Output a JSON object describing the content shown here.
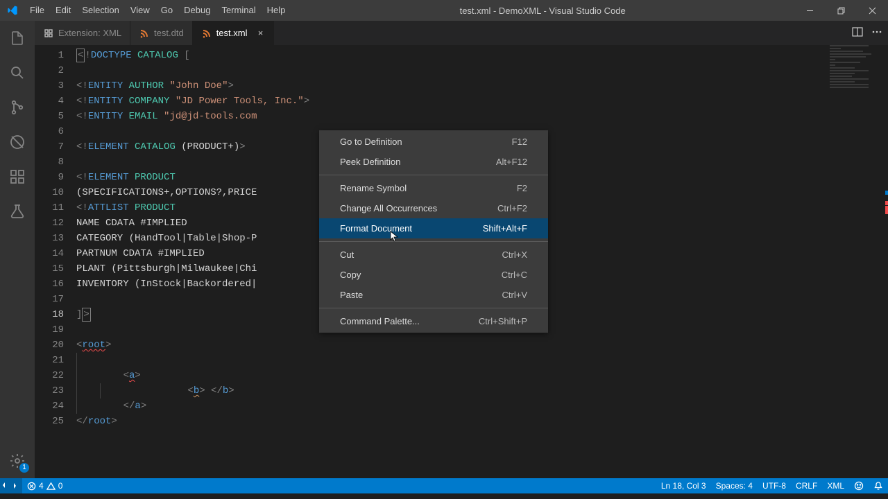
{
  "title": "test.xml - DemoXML - Visual Studio Code",
  "menus": [
    "File",
    "Edit",
    "Selection",
    "View",
    "Go",
    "Debug",
    "Terminal",
    "Help"
  ],
  "activity_badge": "1",
  "tabs": [
    {
      "label": "Extension: XML",
      "icon": "puzzle",
      "active": false,
      "show_close": false
    },
    {
      "label": "test.dtd",
      "icon": "xml",
      "active": false,
      "show_close": false
    },
    {
      "label": "test.xml",
      "icon": "xml",
      "active": true,
      "show_close": true
    }
  ],
  "current_line": 18,
  "code_lines": [
    {
      "n": 1,
      "segs": [
        {
          "t": "span",
          "cls": "box k-gray",
          "v": "<"
        },
        {
          "t": "span",
          "cls": "k-gray",
          "v": "!"
        },
        {
          "t": "span",
          "cls": "k-blue",
          "v": "DOCTYPE "
        },
        {
          "t": "span",
          "cls": "k-teal",
          "v": "CATALOG"
        },
        {
          "t": "span",
          "cls": "",
          "v": " "
        },
        {
          "t": "span",
          "cls": "k-gray",
          "v": "["
        }
      ]
    },
    {
      "n": 2,
      "segs": []
    },
    {
      "n": 3,
      "segs": [
        {
          "t": "span",
          "cls": "k-gray",
          "v": "<!"
        },
        {
          "t": "span",
          "cls": "k-blue",
          "v": "ENTITY "
        },
        {
          "t": "span",
          "cls": "k-teal",
          "v": "AUTHOR"
        },
        {
          "t": "span",
          "cls": "",
          "v": " "
        },
        {
          "t": "span",
          "cls": "k-str",
          "v": "\"John Doe\""
        },
        {
          "t": "span",
          "cls": "k-gray",
          "v": ">"
        }
      ]
    },
    {
      "n": 4,
      "segs": [
        {
          "t": "span",
          "cls": "k-gray",
          "v": "<!"
        },
        {
          "t": "span",
          "cls": "k-blue",
          "v": "ENTITY "
        },
        {
          "t": "span",
          "cls": "k-teal",
          "v": "COMPANY"
        },
        {
          "t": "span",
          "cls": "",
          "v": " "
        },
        {
          "t": "span",
          "cls": "k-str",
          "v": "\"JD Power Tools, Inc.\""
        },
        {
          "t": "span",
          "cls": "k-gray",
          "v": ">"
        }
      ]
    },
    {
      "n": 5,
      "segs": [
        {
          "t": "span",
          "cls": "k-gray",
          "v": "<!"
        },
        {
          "t": "span",
          "cls": "k-blue",
          "v": "ENTITY "
        },
        {
          "t": "span",
          "cls": "k-teal",
          "v": "EMAIL"
        },
        {
          "t": "span",
          "cls": "",
          "v": " "
        },
        {
          "t": "span",
          "cls": "k-str",
          "v": "\"jd@jd-tools.com"
        }
      ]
    },
    {
      "n": 6,
      "segs": []
    },
    {
      "n": 7,
      "segs": [
        {
          "t": "span",
          "cls": "k-gray",
          "v": "<!"
        },
        {
          "t": "span",
          "cls": "k-blue",
          "v": "ELEMENT "
        },
        {
          "t": "span",
          "cls": "k-teal",
          "v": "CATALOG"
        },
        {
          "t": "span",
          "cls": "",
          "v": " (PRODUCT+)"
        },
        {
          "t": "span",
          "cls": "k-gray",
          "v": ">"
        }
      ]
    },
    {
      "n": 8,
      "segs": []
    },
    {
      "n": 9,
      "segs": [
        {
          "t": "span",
          "cls": "k-gray",
          "v": "<!"
        },
        {
          "t": "span",
          "cls": "k-blue",
          "v": "ELEMENT "
        },
        {
          "t": "span",
          "cls": "k-teal",
          "v": "PRODUCT"
        }
      ]
    },
    {
      "n": 10,
      "segs": [
        {
          "t": "span",
          "cls": "",
          "v": "(SPECIFICATIONS+,OPTIONS?,PRICE"
        }
      ]
    },
    {
      "n": 11,
      "segs": [
        {
          "t": "span",
          "cls": "k-gray",
          "v": "<!"
        },
        {
          "t": "span",
          "cls": "k-blue",
          "v": "ATTLIST "
        },
        {
          "t": "span",
          "cls": "k-teal",
          "v": "PRODUCT"
        }
      ]
    },
    {
      "n": 12,
      "segs": [
        {
          "t": "span",
          "cls": "",
          "v": "NAME CDATA #IMPLIED"
        }
      ]
    },
    {
      "n": 13,
      "segs": [
        {
          "t": "span",
          "cls": "",
          "v": "CATEGORY (HandTool|Table|Shop-P"
        }
      ]
    },
    {
      "n": 14,
      "segs": [
        {
          "t": "span",
          "cls": "",
          "v": "PARTNUM CDATA #IMPLIED"
        }
      ]
    },
    {
      "n": 15,
      "segs": [
        {
          "t": "span",
          "cls": "",
          "v": "PLANT (Pittsburgh|Milwaukee|Chi"
        }
      ]
    },
    {
      "n": 16,
      "segs": [
        {
          "t": "span",
          "cls": "",
          "v": "INVENTORY (InStock|Backordered|"
        }
      ]
    },
    {
      "n": 17,
      "segs": []
    },
    {
      "n": 18,
      "segs": [
        {
          "t": "span",
          "cls": "k-gray",
          "v": "]"
        },
        {
          "t": "span",
          "cls": "box k-gray",
          "v": ">"
        }
      ]
    },
    {
      "n": 19,
      "segs": []
    },
    {
      "n": 20,
      "segs": [
        {
          "t": "span",
          "cls": "k-gray",
          "v": "<"
        },
        {
          "t": "span",
          "cls": "k-blue squiggle-red",
          "v": "root"
        },
        {
          "t": "span",
          "cls": "k-gray",
          "v": ">"
        }
      ]
    },
    {
      "n": 21,
      "indent": 1,
      "segs": []
    },
    {
      "n": 22,
      "indent": 1,
      "segs": [
        {
          "t": "raw",
          "v": "    "
        },
        {
          "t": "span",
          "cls": "k-gray",
          "v": "<"
        },
        {
          "t": "span",
          "cls": "k-blue squiggle-red",
          "v": "a"
        },
        {
          "t": "span",
          "cls": "k-gray",
          "v": ">"
        }
      ]
    },
    {
      "n": 23,
      "indent": 2,
      "segs": [
        {
          "t": "raw",
          "v": "           "
        },
        {
          "t": "span",
          "cls": "k-gray",
          "v": "<"
        },
        {
          "t": "span",
          "cls": "k-blue squiggle-orange",
          "v": "b"
        },
        {
          "t": "span",
          "cls": "k-gray",
          "v": ">"
        },
        {
          "t": "raw",
          "v": " "
        },
        {
          "t": "span",
          "cls": "k-gray",
          "v": "</"
        },
        {
          "t": "span",
          "cls": "k-blue",
          "v": "b"
        },
        {
          "t": "span",
          "cls": "k-gray",
          "v": ">"
        }
      ]
    },
    {
      "n": 24,
      "indent": 1,
      "segs": [
        {
          "t": "raw",
          "v": "    "
        },
        {
          "t": "span",
          "cls": "k-gray",
          "v": "</"
        },
        {
          "t": "span",
          "cls": "k-blue",
          "v": "a"
        },
        {
          "t": "span",
          "cls": "k-gray",
          "v": ">"
        }
      ]
    },
    {
      "n": 25,
      "segs": [
        {
          "t": "span",
          "cls": "k-gray",
          "v": "</"
        },
        {
          "t": "span",
          "cls": "k-blue",
          "v": "root"
        },
        {
          "t": "span",
          "cls": "k-gray",
          "v": ">"
        }
      ]
    }
  ],
  "context_menu": [
    {
      "type": "item",
      "label": "Go to Definition",
      "shortcut": "F12"
    },
    {
      "type": "item",
      "label": "Peek Definition",
      "shortcut": "Alt+F12"
    },
    {
      "type": "sep"
    },
    {
      "type": "item",
      "label": "Rename Symbol",
      "shortcut": "F2"
    },
    {
      "type": "item",
      "label": "Change All Occurrences",
      "shortcut": "Ctrl+F2"
    },
    {
      "type": "item",
      "label": "Format Document",
      "shortcut": "Shift+Alt+F",
      "selected": true
    },
    {
      "type": "sep"
    },
    {
      "type": "item",
      "label": "Cut",
      "shortcut": "Ctrl+X"
    },
    {
      "type": "item",
      "label": "Copy",
      "shortcut": "Ctrl+C"
    },
    {
      "type": "item",
      "label": "Paste",
      "shortcut": "Ctrl+V"
    },
    {
      "type": "sep"
    },
    {
      "type": "item",
      "label": "Command Palette...",
      "shortcut": "Ctrl+Shift+P"
    }
  ],
  "status": {
    "errors": "4",
    "warnings": "0",
    "position": "Ln 18, Col 3",
    "spaces": "Spaces: 4",
    "encoding": "UTF-8",
    "eol": "CRLF",
    "language": "XML"
  }
}
